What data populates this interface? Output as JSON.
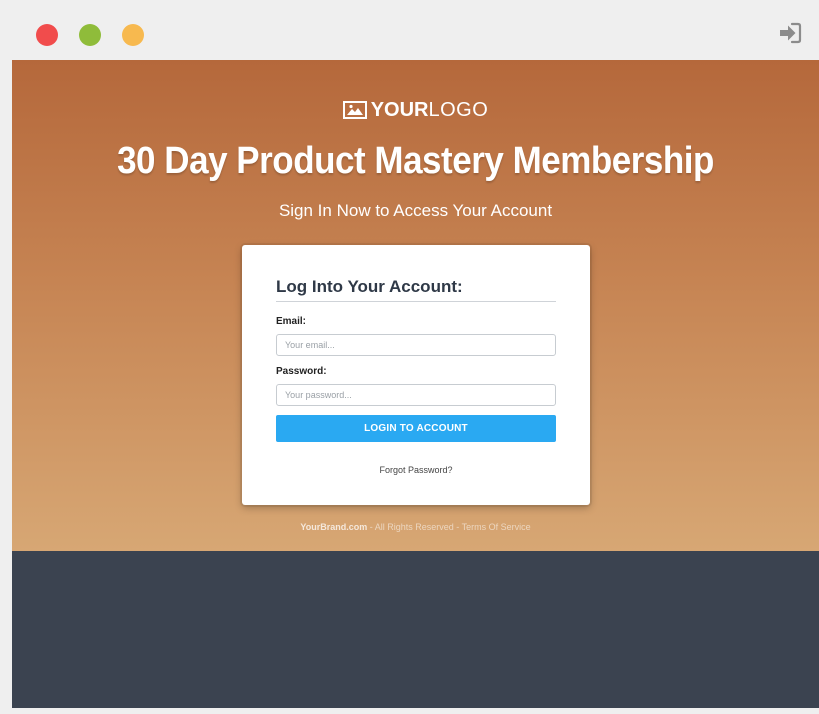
{
  "window": {
    "controls": [
      "close",
      "minimize",
      "maximize"
    ],
    "signin_icon": "sign-in-icon"
  },
  "colors": {
    "hero_top": "#b5683b",
    "hero_bottom": "#d7a774",
    "dark_band": "#3b4350",
    "button": "#2aa9f2"
  },
  "header": {
    "logo_icon": "image-icon",
    "logo_strong": "YOUR",
    "logo_light": "LOGO",
    "headline": "30 Day Product Mastery Membership",
    "subhead": "Sign In Now to Access Your Account"
  },
  "login": {
    "title": "Log Into Your Account:",
    "email_label": "Email:",
    "email_placeholder": "Your email...",
    "email_value": "",
    "password_label": "Password:",
    "password_placeholder": "Your password...",
    "password_value": "",
    "button_label": "LOGIN TO ACCOUNT",
    "forgot_label": "Forgot Password?"
  },
  "footer": {
    "brand": "YourBrand.com",
    "sep1": " - ",
    "rights": "All Rights Reserved",
    "sep2": " - ",
    "terms": "Terms Of Service"
  }
}
